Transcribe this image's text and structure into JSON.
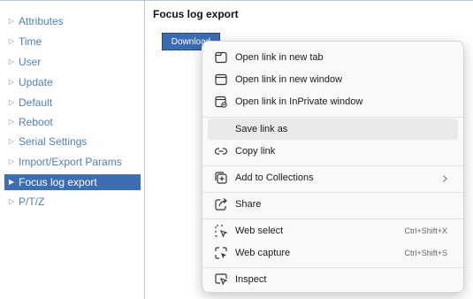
{
  "sidebar": {
    "items": [
      {
        "label": "Attributes"
      },
      {
        "label": "Time"
      },
      {
        "label": "User"
      },
      {
        "label": "Update"
      },
      {
        "label": "Default"
      },
      {
        "label": "Reboot"
      },
      {
        "label": "Serial Settings"
      },
      {
        "label": "Import/Export Params"
      },
      {
        "label": "Focus log export",
        "active": true
      },
      {
        "label": "P/T/Z"
      }
    ]
  },
  "main": {
    "title": "Focus log export",
    "download_label": "Download"
  },
  "context_menu": {
    "items": [
      {
        "label": "Open link in new tab",
        "icon": "new-tab-icon"
      },
      {
        "label": "Open link in new window",
        "icon": "new-window-icon"
      },
      {
        "label": "Open link in InPrivate window",
        "icon": "inprivate-window-icon"
      },
      {
        "label": "Save link as",
        "icon": "none"
      },
      {
        "label": "Copy link",
        "icon": "link-icon"
      },
      {
        "label": "Add to Collections",
        "icon": "collections-icon"
      },
      {
        "label": "Share",
        "icon": "share-icon"
      },
      {
        "label": "Web select",
        "icon": "web-select-icon",
        "shortcut": "Ctrl+Shift+X"
      },
      {
        "label": "Web capture",
        "icon": "web-capture-icon",
        "shortcut": "Ctrl+Shift+S"
      },
      {
        "label": "Inspect",
        "icon": "inspect-icon"
      }
    ]
  },
  "colors": {
    "nav_link": "#4f7fb3",
    "nav_active_bg": "#3d6db3",
    "button_bg": "#3a6cb5",
    "menu_bg": "#f9f9f9",
    "menu_hover": "#e9e9e9"
  }
}
